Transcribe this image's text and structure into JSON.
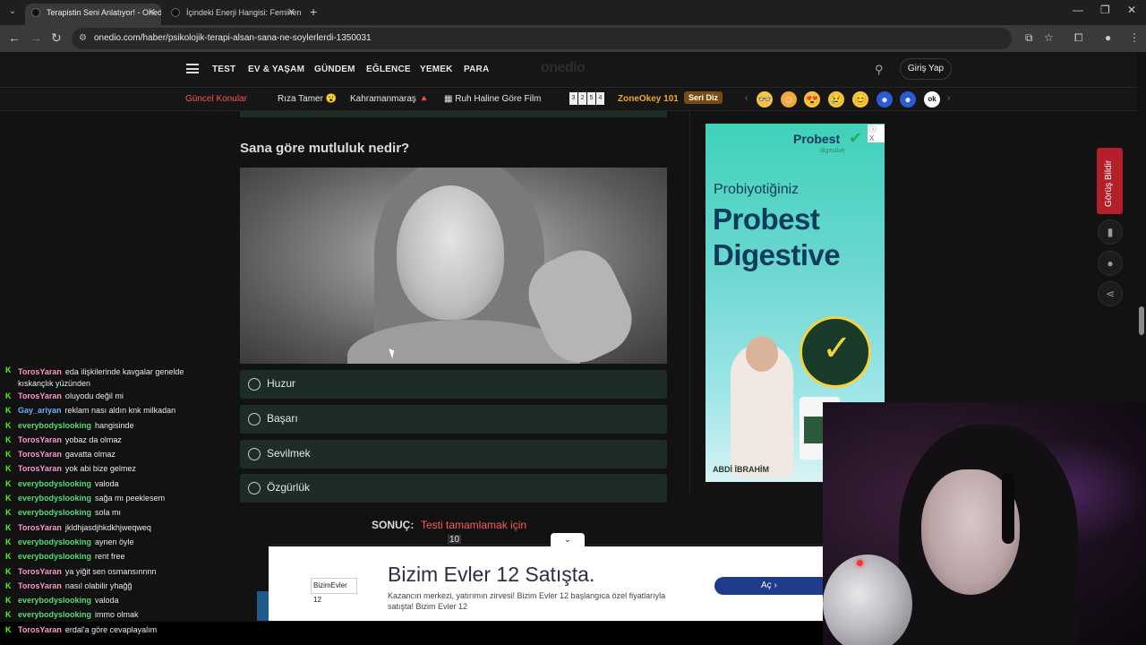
{
  "browser": {
    "tabs": [
      {
        "title": "Terapistin Seni Anlatıyor! - Onedio",
        "active": true
      },
      {
        "title": "İçindeki Enerji Hangisi: Feminen",
        "active": false
      }
    ],
    "url": "onedio.com/haber/psikolojik-terapi-alsan-sana-ne-soylerlerdi-1350031"
  },
  "site": {
    "logo": "onedio",
    "nav": [
      "TEST",
      "EV & YAŞAM",
      "GÜNDEM",
      "EĞLENCE",
      "YEMEK",
      "PARA"
    ],
    "login": "Giriş Yap",
    "topics": {
      "current_label": "Güncel Konular",
      "items": [
        "Rıza Tamer 😮",
        "Kahramanmaraş 🔺",
        "Ruh Haline Göre Film"
      ],
      "zoneokey": "ZoneOkey 101",
      "seri_diz": "Seri Diz",
      "grid_digits": [
        "3",
        "2",
        "5",
        "4"
      ]
    }
  },
  "quiz": {
    "question": "Sana göre mutluluk nedir?",
    "options": [
      "Huzur",
      "Başarı",
      "Sevilmek",
      "Özgürlük"
    ],
    "result_label": "SONUÇ:",
    "result_text": "Testi tamamlamak için",
    "counter": "10"
  },
  "ad": {
    "brand": "Probest",
    "brand_sub": "digestive",
    "line1": "Probiyotiğiniz",
    "line2": "Probest",
    "line3": "Digestive",
    "company": "ABDİ İBRAHİM",
    "info": "ⓘ X"
  },
  "side": {
    "feedback": "Görüş Bildir"
  },
  "bottom_ad": {
    "logo": "BizimEvler 12",
    "title": "Bizim Evler 12 Satışta.",
    "desc": "Kazancın merkezi, yatırımın zirvesi! Bizim Evler 12 başlangıca özel fiyatlarıyla satışta! Bizim Evler 12",
    "cta": "Aç"
  },
  "chat": [
    {
      "user": "TorosYaran",
      "color": "#ff9ad0",
      "text": "eda ilişkilerinde kavgalar genelde kıskançlık yüzünden",
      "wrap": true
    },
    {
      "user": "TorosYaran",
      "color": "#ff9ad0",
      "text": "oluyodu değil mi"
    },
    {
      "user": "Gay_ariyan",
      "color": "#6fb7ff",
      "text": "reklam nası aldın knk milkadan"
    },
    {
      "user": "everybodyslooking",
      "color": "#57e07a",
      "text": "hangisinde"
    },
    {
      "user": "TorosYaran",
      "color": "#ff9ad0",
      "text": "yobaz da olmaz"
    },
    {
      "user": "TorosYaran",
      "color": "#ff9ad0",
      "text": "gavatta olmaz"
    },
    {
      "user": "TorosYaran",
      "color": "#ff9ad0",
      "text": "yok abi bize gelmez"
    },
    {
      "user": "everybodyslooking",
      "color": "#57e07a",
      "text": "valoda"
    },
    {
      "user": "everybodyslooking",
      "color": "#57e07a",
      "text": "sağa mı peeklesem"
    },
    {
      "user": "everybodyslooking",
      "color": "#57e07a",
      "text": "sola mı"
    },
    {
      "user": "TorosYaran",
      "color": "#ff9ad0",
      "text": "jkldhjasdjhkdkhjweqweq"
    },
    {
      "user": "everybodyslooking",
      "color": "#57e07a",
      "text": "aynen öyle"
    },
    {
      "user": "everybodyslooking",
      "color": "#57e07a",
      "text": "rent free"
    },
    {
      "user": "TorosYaran",
      "color": "#ff9ad0",
      "text": "ya yiğit sen osmansınnnn"
    },
    {
      "user": "TorosYaran",
      "color": "#ff9ad0",
      "text": "nasıl olabilir yhağğ"
    },
    {
      "user": "everybodyslooking",
      "color": "#57e07a",
      "text": "valoda"
    },
    {
      "user": "everybodyslooking",
      "color": "#57e07a",
      "text": "immo olmak"
    },
    {
      "user": "TorosYaran",
      "color": "#ff9ad0",
      "text": "erdal'a göre cevaplayalım"
    }
  ],
  "icons": {
    "back": "←",
    "forward": "→",
    "reload": "↻",
    "search": "🔍"
  }
}
